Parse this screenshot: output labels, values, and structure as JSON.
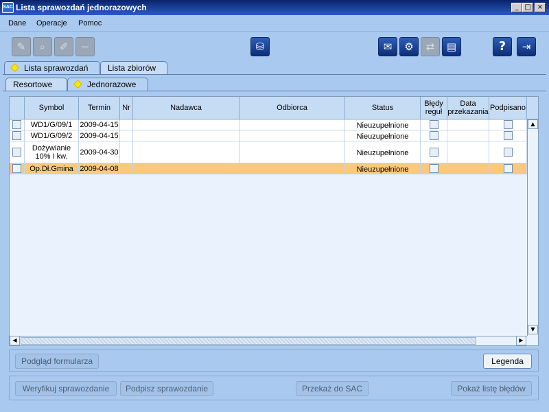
{
  "window": {
    "logo_text": "SAC",
    "title": "Lista sprawozdań jednorazowych",
    "minimize": "_",
    "maximize": "□",
    "close": "×"
  },
  "menu": [
    "Dane",
    "Operacje",
    "Pomoc"
  ],
  "toolbar": {
    "left_icons": [
      "edit-record-icon",
      "search-icon",
      "pencil-icon",
      "minus-icon"
    ],
    "center_icon": "database-icon",
    "right_icons": [
      "mail-icon",
      "settings-icon",
      "transfer-icon",
      "document-icon"
    ],
    "help_icon": "help-icon",
    "exit_icon": "exit-icon"
  },
  "tabs_top": [
    "Lista sprawozdań",
    "Lista zbiorów"
  ],
  "tabs_sub": [
    "Resortowe",
    "Jednorazowe"
  ],
  "table": {
    "columns": [
      "",
      "Symbol",
      "Termin",
      "Nr",
      "Nadawca",
      "Odbiorca",
      "Status",
      "Błędy reguł",
      "Data przekazania",
      "Podpisano"
    ],
    "rows": [
      {
        "symbol": "WD1/G/09/1",
        "termin": "2009-04-15",
        "nr": "",
        "nadawca": "",
        "odbiorca": "",
        "status": "Nieuzupełnione",
        "data": ""
      },
      {
        "symbol": "WD1/G/09/2",
        "termin": "2009-04-15",
        "nr": "",
        "nadawca": "",
        "odbiorca": "",
        "status": "Nieuzupełnione",
        "data": ""
      },
      {
        "symbol": "Dożywianie 10% I kw.",
        "termin": "2009-04-30",
        "nr": "",
        "nadawca": "",
        "odbiorca": "",
        "status": "Nieuzupełnione",
        "data": ""
      },
      {
        "symbol": "Op.Dł.Gmina",
        "termin": "2009-04-08",
        "nr": "",
        "nadawca": "",
        "odbiorca": "",
        "status": "Nieuzupełnione",
        "data": "",
        "selected": true
      }
    ]
  },
  "scroll": {
    "up": "▲",
    "down": "▼",
    "left": "◀",
    "right": "▶"
  },
  "buttons": {
    "preview": "Podgląd formularza",
    "legend": "Legenda",
    "verify": "Weryfikuj sprawozdanie",
    "sign": "Podpisz sprawozdanie",
    "send": "Przekaż do SAC",
    "errors": "Pokaż listę błędów"
  }
}
